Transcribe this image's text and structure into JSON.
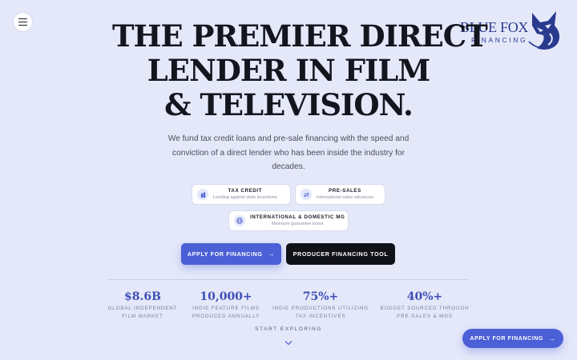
{
  "header": {
    "menu_icon": "hamburger-menu-icon",
    "logo": {
      "line1": "BLUE FOX",
      "line2": "FINANCING",
      "icon": "fox-head-icon",
      "color": "#2a3a8f"
    }
  },
  "hero": {
    "headline_line1": "THE PREMIER DIRECT",
    "headline_line2": "LENDER IN FILM",
    "headline_line3": "& TELEVISION.",
    "subtitle": "We fund tax credit loans and pre-sale financing with the speed and conviction of a direct lender who has been inside the industry for decades."
  },
  "pills": [
    {
      "title": "TAX CREDIT",
      "subtitle": "Lending against state incentives",
      "icon": "building-icon"
    },
    {
      "title": "PRE-SALES",
      "subtitle": "International sales advances",
      "icon": "exchange-arrows-icon"
    },
    {
      "title": "INTERNATIONAL & DOMESTIC MG",
      "subtitle": "Minimum guarantee loans",
      "icon": "globe-icon"
    }
  ],
  "buttons": {
    "apply": "APPLY FOR FINANCING",
    "tool": "PRODUCER FINANCING TOOL"
  },
  "stats": [
    {
      "value": "$8.6B",
      "label_line1": "GLOBAL INDEPENDENT",
      "label_line2": "FILM MARKET"
    },
    {
      "value": "10,000+",
      "label_line1": "INDIE FEATURE FILMS",
      "label_line2": "PRODUCED ANNUALLY"
    },
    {
      "value": "75%+",
      "label_line1": "INDIE PRODUCTIONS UTILIZING",
      "label_line2": "TAX INCENTIVES"
    },
    {
      "value": "40%+",
      "label_line1": "BUDGET SOURCED THROUGH",
      "label_line2": "PRE-SALES & MGS"
    }
  ],
  "explore": {
    "label": "START EXPLORING",
    "icon": "chevron-down-icon"
  },
  "floating_cta": {
    "label": "APPLY FOR FINANCING",
    "icon": "arrow-right-icon"
  },
  "colors": {
    "background": "#e4e8f9",
    "accent": "#4b5fd6",
    "dark": "#111218",
    "stat_value": "#3f4fb6"
  }
}
